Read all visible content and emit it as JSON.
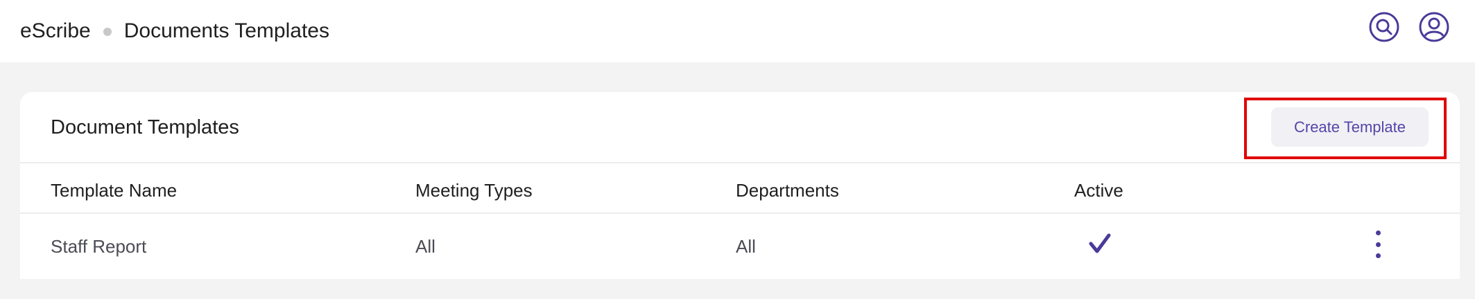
{
  "breadcrumb": {
    "app": "eScribe",
    "page": "Documents Templates"
  },
  "header_icons": {
    "search": "search-icon",
    "account": "user-account-icon"
  },
  "card": {
    "title": "Document Templates",
    "create_button_label": "Create Template"
  },
  "table": {
    "columns": [
      "Template Name",
      "Meeting Types",
      "Departments",
      "Active"
    ],
    "rows": [
      {
        "template_name": "Staff Report",
        "meeting_types": "All",
        "departments": "All",
        "active": true
      }
    ]
  },
  "colors": {
    "accent": "#4a3a99",
    "button_text": "#5544a8",
    "highlight": "#e00000",
    "background": "#f3f3f3"
  }
}
